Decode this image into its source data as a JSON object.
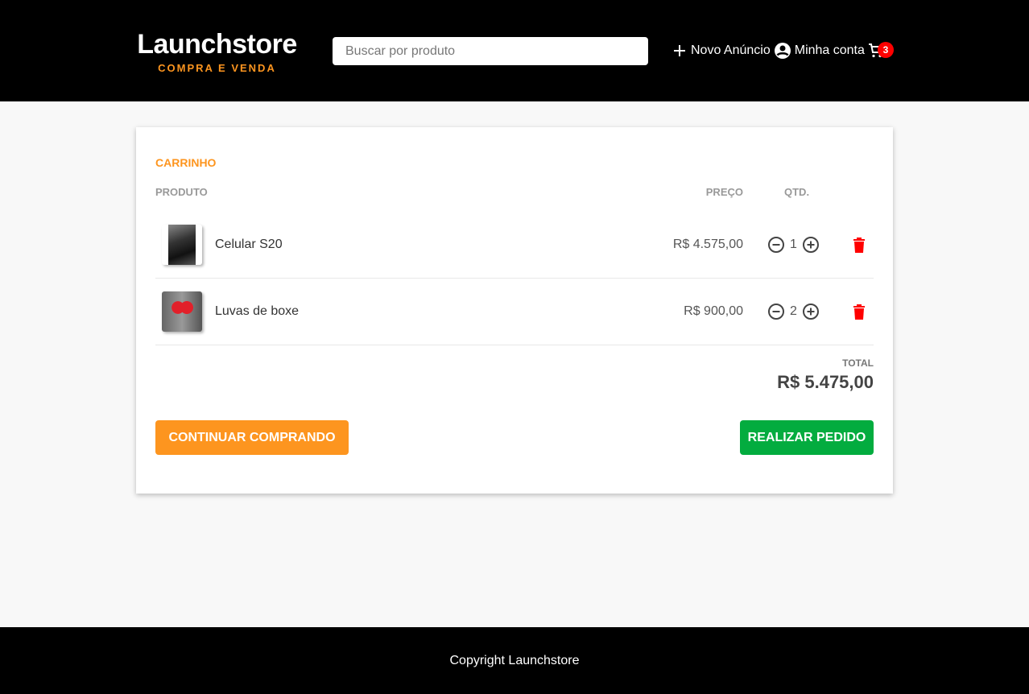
{
  "header": {
    "logo_title": "Launchstore",
    "logo_subtitle": "COMPRA E VENDA",
    "search_placeholder": "Buscar por produto",
    "new_ad": "Novo Anúncio",
    "account": "Minha conta",
    "cart_count": "3"
  },
  "cart": {
    "title": "CARRINHO",
    "col_product": "PRODUTO",
    "col_price": "PREÇO",
    "col_qty": "QTD.",
    "items": [
      {
        "name": "Celular S20",
        "price": "R$ 4.575,00",
        "qty": "1"
      },
      {
        "name": "Luvas de boxe",
        "price": "R$ 900,00",
        "qty": "2"
      }
    ],
    "total_label": "TOTAL",
    "total_value": "R$ 5.475,00",
    "continue_label": "CONTINUAR COMPRANDO",
    "order_label": "REALIZAR PEDIDO"
  },
  "footer": {
    "text": "Copyright Launchstore"
  }
}
